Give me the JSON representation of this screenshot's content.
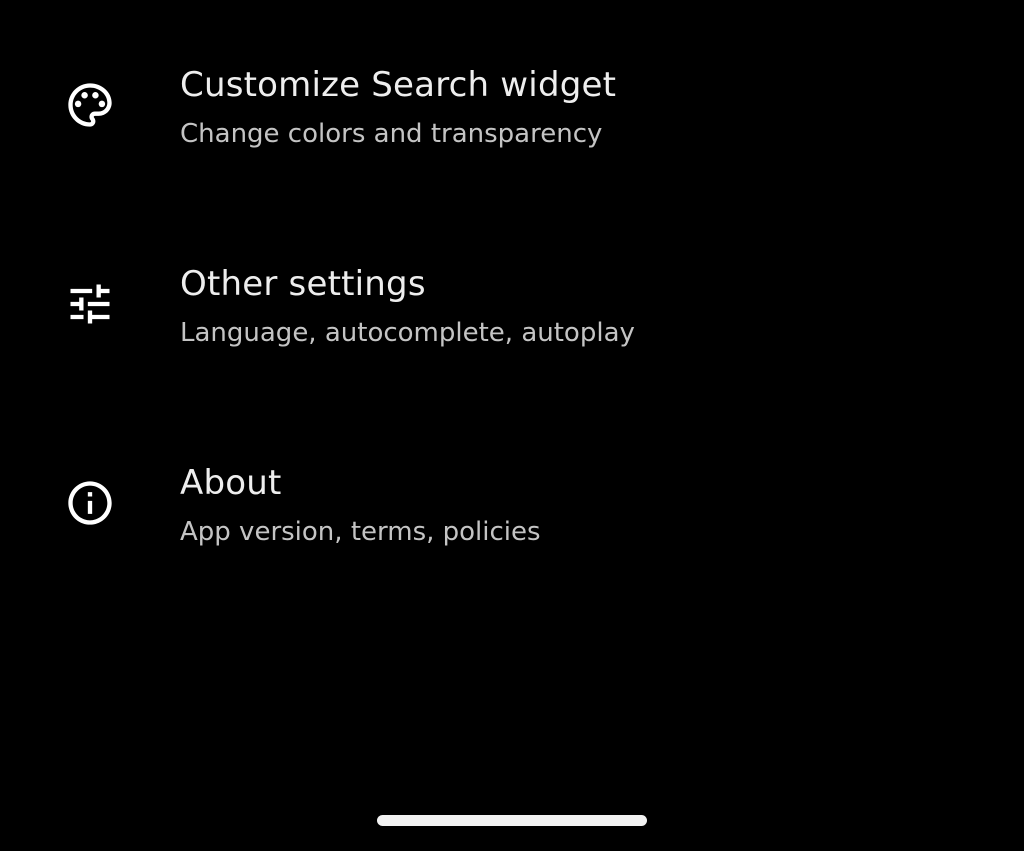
{
  "settings": {
    "items": [
      {
        "icon": "palette-icon",
        "title": "Customize Search widget",
        "subtitle": "Change colors and transparency"
      },
      {
        "icon": "tune-icon",
        "title": "Other settings",
        "subtitle": "Language, autocomplete, autoplay"
      },
      {
        "icon": "info-icon",
        "title": "About",
        "subtitle": "App version, terms, policies"
      }
    ]
  },
  "colors": {
    "background": "#000000",
    "title_text": "#eeeeee",
    "subtitle_text": "#c4c4c4",
    "icon": "#ffffff"
  }
}
